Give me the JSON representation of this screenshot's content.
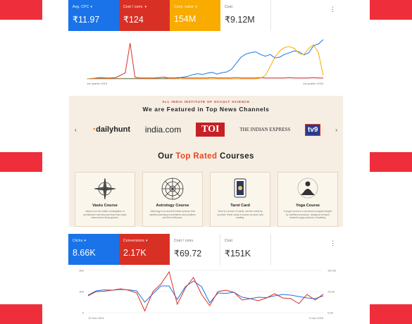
{
  "dashboard_top": {
    "tiles": [
      {
        "label": "Avg. CPC",
        "value": "₹11.97",
        "bg": "#1a73e8",
        "dropdown": true
      },
      {
        "label": "Cost / conv.",
        "value": "₹124",
        "bg": "#d93025",
        "dropdown": true
      },
      {
        "label": "Conv. value",
        "value": "154M",
        "bg": "#f9ab00",
        "dropdown": true
      },
      {
        "label": "Cost",
        "value": "₹9.12M",
        "bg": "#ffffff",
        "dropdown": false
      }
    ],
    "menu_icon": "more-vert-icon",
    "chart_data": {
      "type": "line",
      "x_start_label": "1st quarter 2015",
      "x_end_label": "1st quarter 2025",
      "series": [
        {
          "color": "#1a73e8",
          "values": [
            0,
            1,
            1,
            1,
            1,
            1,
            1,
            1,
            1,
            1,
            1,
            1,
            1,
            1,
            1,
            1,
            1,
            2,
            2,
            2,
            4,
            6,
            10,
            12,
            10,
            13,
            15,
            11,
            14,
            16,
            22,
            36,
            50,
            57,
            60,
            62,
            56,
            52,
            56,
            48,
            50,
            56,
            60,
            64,
            62,
            55,
            60,
            76,
            80,
            90
          ]
        },
        {
          "color": "#d93025",
          "values": [
            0,
            0,
            2,
            3,
            2,
            2,
            3,
            8,
            14,
            82,
            4,
            2,
            2,
            2,
            2,
            3,
            4,
            2,
            2,
            3,
            2,
            2,
            2,
            2,
            2,
            2,
            3,
            2,
            2,
            2,
            2,
            3,
            2,
            2,
            2,
            2,
            3,
            2,
            2,
            2,
            2,
            2,
            3,
            2,
            2,
            2,
            2,
            3,
            2,
            2
          ]
        },
        {
          "color": "#f9ab00",
          "values": [
            0,
            0,
            0,
            0,
            0,
            0,
            0,
            0,
            0,
            0,
            0,
            0,
            0,
            0,
            0,
            0,
            0,
            0,
            0,
            0,
            0,
            0,
            0,
            0,
            0,
            0,
            0,
            0,
            0,
            0,
            0,
            0,
            0,
            0,
            0,
            0,
            2,
            8,
            28,
            50,
            64,
            72,
            74,
            70,
            58,
            56,
            70,
            78,
            60,
            8
          ]
        }
      ]
    }
  },
  "banner": {
    "institute": "ALL INDIA INSTITUTE OF OCCULT SCIENCE",
    "featured": "We are Featured in Top News Channels",
    "logos": [
      "dailyhunt",
      "india.com",
      "TOI",
      "THE INDIAN EXPRESS",
      "tv9"
    ],
    "courses_prefix": "Our ",
    "courses_highlight": "Top Rated",
    "courses_suffix": " Courses",
    "cards": [
      {
        "title": "Vastu Course",
        "desc": "Vastu is an old Indian investigation of architecture and structure that help make harmonious living spaces."
      },
      {
        "title": "Astrology Course",
        "desc": "Astrology is an ancient Indian science that clarifies planetary movements and positions and their influence."
      },
      {
        "title": "Tarot Card",
        "desc": "Tarot is a bunch of cards, see the world by yourself, these cards is known as tarot card reading."
      },
      {
        "title": "Yoga Course",
        "desc": "A yoga course is a structured program taught by certified instructors, designed to teach students yoga postures, breathing."
      }
    ]
  },
  "dashboard_bottom": {
    "tiles": [
      {
        "label": "Clicks",
        "value": "8.66K",
        "bg": "#1a73e8",
        "dropdown": true
      },
      {
        "label": "Conversions",
        "value": "2.17K",
        "bg": "#d93025",
        "dropdown": true
      },
      {
        "label": "Cost / conv.",
        "value": "₹69.72",
        "bg": "#ffffff",
        "dropdown": false
      },
      {
        "label": "Cost",
        "value": "₹151K",
        "bg": "#ffffff",
        "dropdown": false
      }
    ],
    "menu_icon": "more-vert-icon",
    "chart_data": {
      "type": "line",
      "x_start_label": "12 Dec 2024",
      "x_end_label": "8 Jan 2025",
      "left_ticks": [
        "600",
        "300",
        "0"
      ],
      "right_ticks": [
        "140.00",
        "70.00",
        "0.00"
      ],
      "left_ylim": [
        0,
        600
      ],
      "right_ylim": [
        0,
        140
      ],
      "series": [
        {
          "name": "Clicks",
          "color": "#1a73e8",
          "axis": "left",
          "values": [
            250,
            310,
            325,
            320,
            330,
            325,
            310,
            150,
            270,
            380,
            380,
            190,
            370,
            450,
            370,
            140,
            280,
            275,
            290,
            220,
            200,
            220,
            215,
            240,
            260,
            250,
            230,
            210,
            200,
            240
          ]
        },
        {
          "name": "Conversions",
          "color": "#d93025",
          "axis": "left",
          "values": [
            240,
            300,
            305,
            320,
            340,
            320,
            280,
            25,
            300,
            410,
            580,
            120,
            350,
            500,
            260,
            100,
            300,
            320,
            290,
            180,
            200,
            170,
            210,
            270,
            210,
            200,
            130,
            260,
            180,
            265
          ]
        }
      ]
    }
  }
}
